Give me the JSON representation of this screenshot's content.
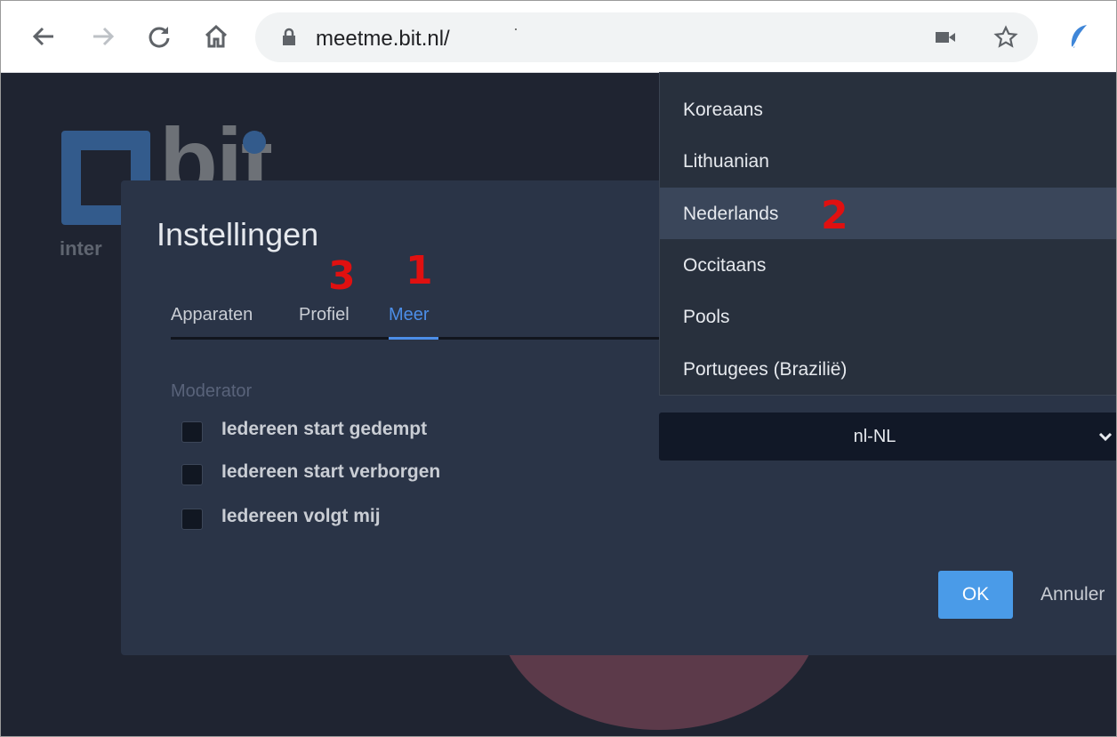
{
  "browser": {
    "url": "meetme.bit.nl/"
  },
  "background": {
    "logo_text": "bit",
    "logo_subtext": "inter"
  },
  "dialog": {
    "title": "Instellingen",
    "tabs": [
      {
        "label": "Apparaten",
        "active": false
      },
      {
        "label": "Profiel",
        "active": false
      },
      {
        "label": "Meer",
        "active": true
      }
    ],
    "section_label": "Moderator",
    "checkboxes": [
      {
        "label": "Iedereen start gedempt",
        "checked": false
      },
      {
        "label": "Iedereen start verborgen",
        "checked": false
      },
      {
        "label": "Iedereen volgt mij",
        "checked": false
      }
    ],
    "language_select_value": "nl-NL",
    "ok_label": "OK",
    "cancel_label": "Annuler"
  },
  "dropdown": {
    "items": [
      "Koreaans",
      "Lithuanian",
      "Nederlands",
      "Occitaans",
      "Pools",
      "Portugees (Brazilië)"
    ],
    "selected": "Nederlands"
  },
  "annotations": {
    "tab_meer": "1",
    "nederlands": "2",
    "tab_profiel": "3"
  },
  "colors": {
    "accent": "#4c8ee8",
    "ok_button": "#4a9be8",
    "annotation": "#e01010",
    "dialog_bg": "#2a3447"
  }
}
